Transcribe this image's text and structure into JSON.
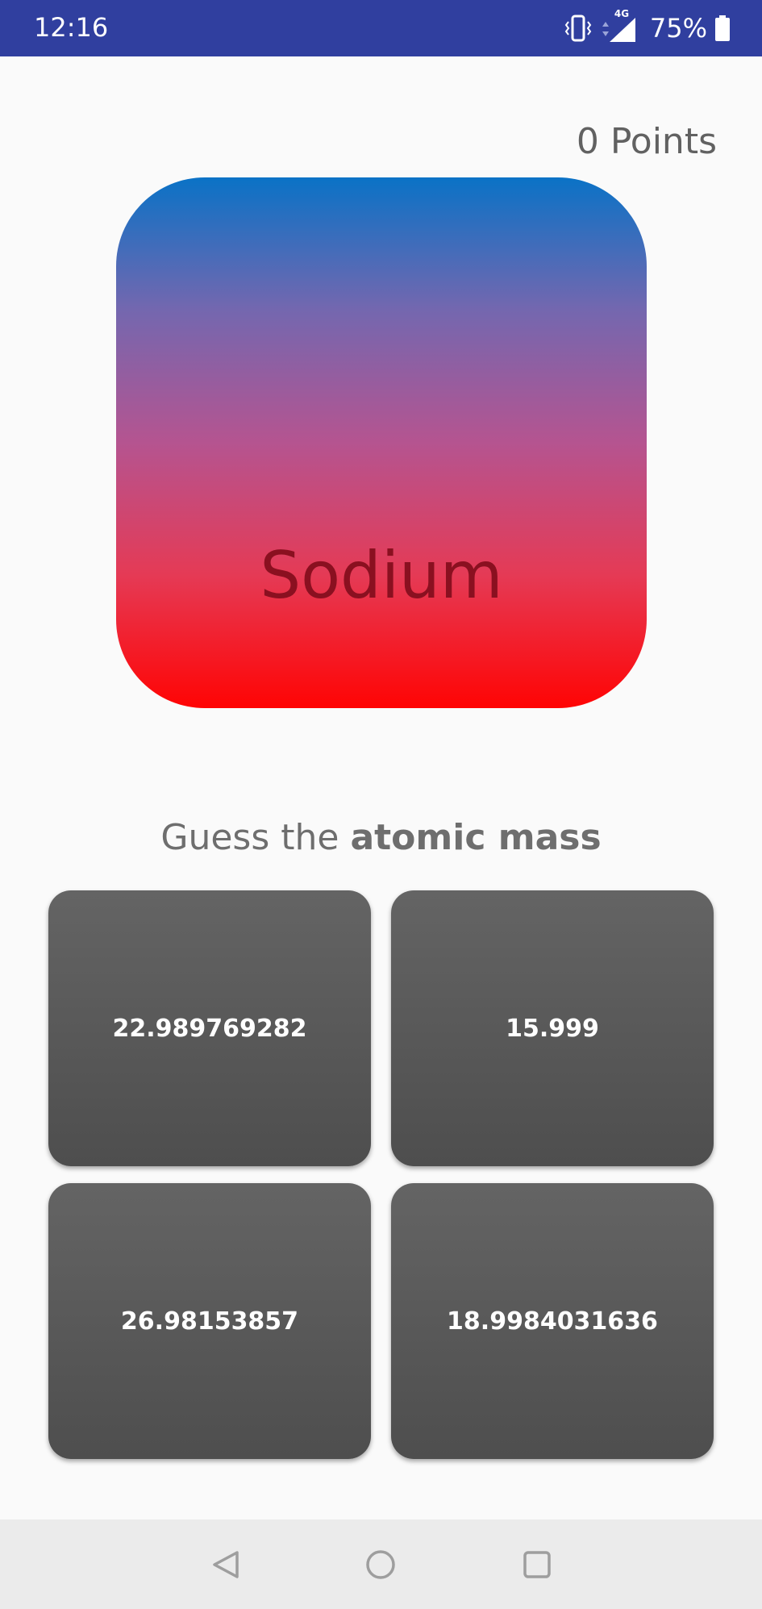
{
  "status_bar": {
    "time": "12:16",
    "network": "4G",
    "battery_percent": "75%"
  },
  "game": {
    "points_label": "0 Points",
    "element_name": "Sodium",
    "card_gradient": [
      "#0a72c6",
      "#ff0404"
    ],
    "prompt_prefix": "Guess the ",
    "prompt_property": "atomic mass",
    "answers": [
      {
        "label": "22.989769282"
      },
      {
        "label": "15.999"
      },
      {
        "label": "26.98153857"
      },
      {
        "label": "18.9984031636"
      }
    ]
  },
  "colors": {
    "status_bar": "#303f9f",
    "background": "#fafafa",
    "answer_button": "#595959",
    "nav_bar": "#ebebeb"
  },
  "icons": {
    "vibrate": "vibrate-icon",
    "signal": "signal-icon",
    "battery": "battery-icon",
    "nav_back": "back-icon",
    "nav_home": "home-icon",
    "nav_recents": "recents-icon"
  }
}
